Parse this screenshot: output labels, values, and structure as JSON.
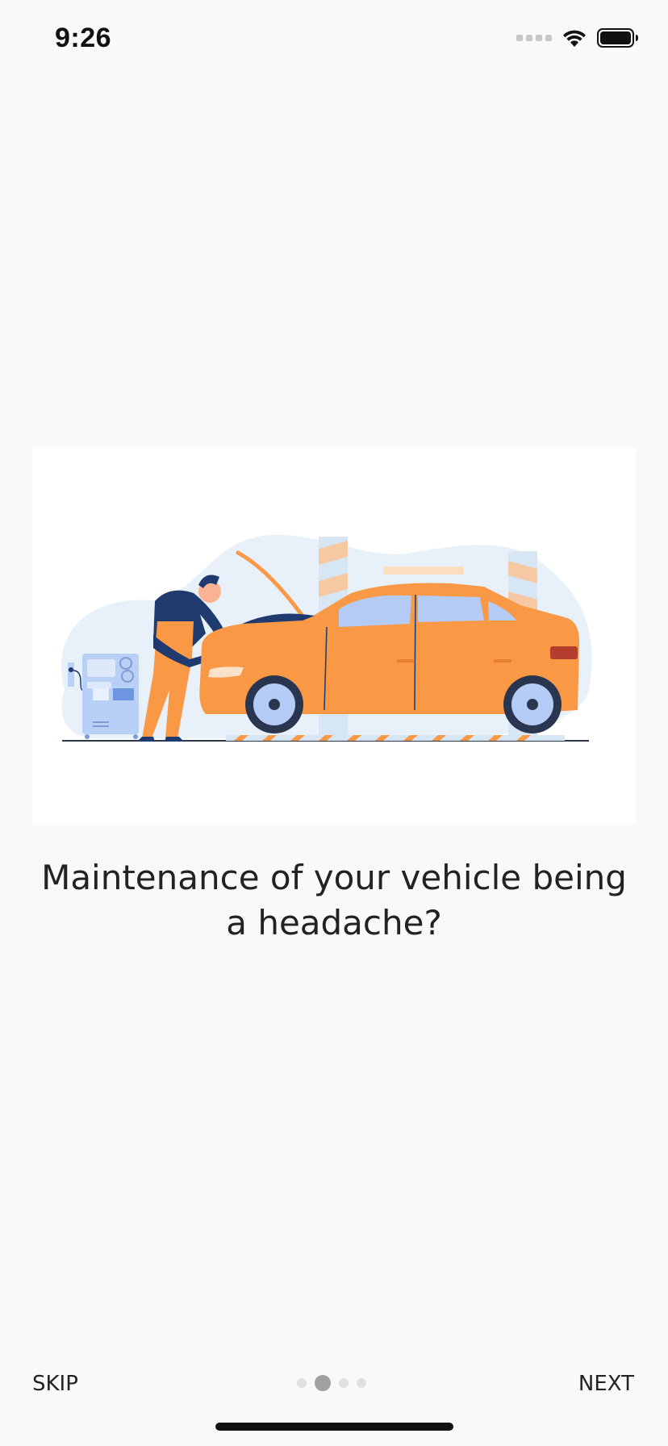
{
  "status_bar": {
    "time": "9:26"
  },
  "onboarding": {
    "headline": "Maintenance of your vehicle being a headache?",
    "illustration": "mechanic-repairing-car-illustration",
    "pager": {
      "current_page": 2,
      "total_pages": 4
    }
  },
  "bottom_bar": {
    "skip_label": "SKIP",
    "next_label": "NEXT"
  },
  "colors": {
    "background": "#f9f9f9",
    "car_orange": "#F99845",
    "mechanic_navy": "#1E3A6E",
    "blob_blue": "#E8F1FA",
    "pager_active": "#a0a0a0",
    "pager_inactive": "#e0e0e0"
  }
}
